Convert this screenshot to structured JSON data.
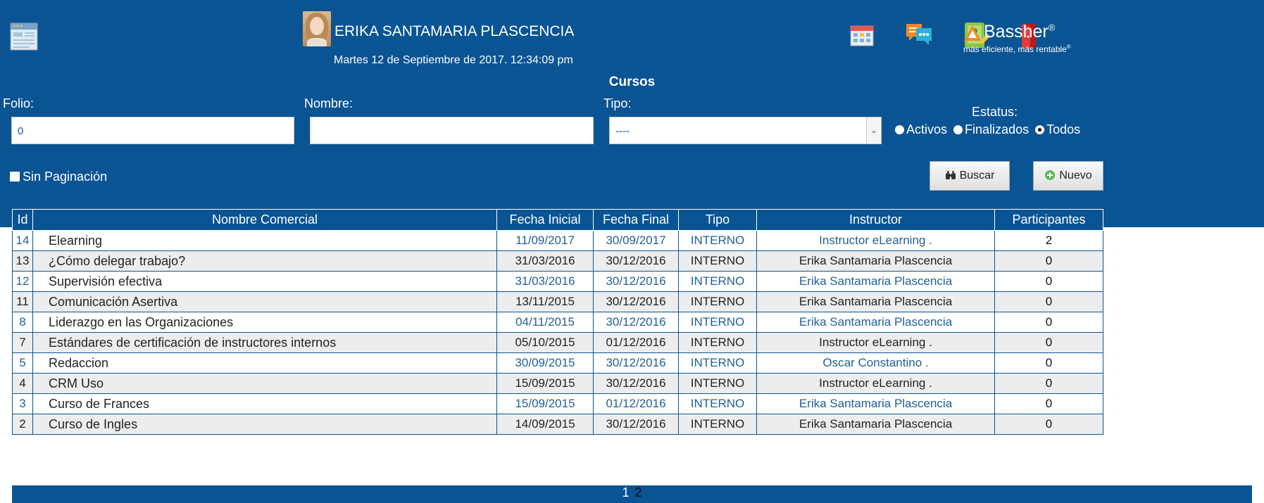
{
  "header": {
    "user_name": "ERIKA SANTAMARIA PLASCENCIA",
    "date": "Martes 12 de Septiembre de 2017. 12:34:09 pm",
    "brand_name": "Bassher",
    "brand_mark": "®",
    "brand_tagline": "más eficiente, más rentable",
    "brand_tagline_mark": "®",
    "icons": [
      "app-window-icon",
      "calendar-icon",
      "chat-icon",
      "tablet-user-icon",
      "exit-door-icon",
      "bassher-logo"
    ],
    "colors": {
      "header_bg": "#0a5494",
      "row_even_bg": "#ededed",
      "link_text": "#1f5f95"
    }
  },
  "page": {
    "title": "Cursos"
  },
  "filters": {
    "folio_label": "Folio:",
    "folio_value": "0",
    "nombre_label": "Nombre:",
    "nombre_value": "",
    "tipo_label": "Tipo:",
    "tipo_value": "----",
    "estatus_label": "Estatus:",
    "estatus_options": [
      "Activos",
      "Finalizados",
      "Todos"
    ],
    "estatus_selected": "Todos",
    "sin_paginacion_label": "Sin Paginación",
    "buscar_label": "Buscar",
    "nuevo_label": "Nuevo"
  },
  "table": {
    "headers": [
      "Id",
      "Nombre Comercial",
      "Fecha Inicial",
      "Fecha Final",
      "Tipo",
      "Instructor",
      "Participantes"
    ],
    "rows": [
      {
        "id": "14",
        "nombre": "Elearning",
        "inicio": "11/09/2017",
        "fin": "30/09/2017",
        "tipo": "INTERNO",
        "instructor": "Instructor eLearning .",
        "participantes": "2"
      },
      {
        "id": "13",
        "nombre": "¿Cómo delegar trabajo?",
        "inicio": "31/03/2016",
        "fin": "30/12/2016",
        "tipo": "INTERNO",
        "instructor": "Erika Santamaria Plascencia",
        "participantes": "0"
      },
      {
        "id": "12",
        "nombre": "Supervisión efectiva",
        "inicio": "31/03/2016",
        "fin": "30/12/2016",
        "tipo": "INTERNO",
        "instructor": "Erika Santamaria Plascencia",
        "participantes": "0"
      },
      {
        "id": "11",
        "nombre": "Comunicación Asertiva",
        "inicio": "13/11/2015",
        "fin": "30/12/2016",
        "tipo": "INTERNO",
        "instructor": "Erika Santamaria Plascencia",
        "participantes": "0"
      },
      {
        "id": "8",
        "nombre": "Liderazgo en las Organizaciones",
        "inicio": "04/11/2015",
        "fin": "30/12/2016",
        "tipo": "INTERNO",
        "instructor": "Erika Santamaria Plascencia",
        "participantes": "0"
      },
      {
        "id": "7",
        "nombre": "Estándares de certificación de instructores internos",
        "inicio": "05/10/2015",
        "fin": "01/12/2016",
        "tipo": "INTERNO",
        "instructor": "Instructor eLearning .",
        "participantes": "0"
      },
      {
        "id": "5",
        "nombre": "Redaccion",
        "inicio": "30/09/2015",
        "fin": "30/12/2016",
        "tipo": "INTERNO",
        "instructor": "Oscar Constantino .",
        "participantes": "0"
      },
      {
        "id": "4",
        "nombre": "CRM Uso",
        "inicio": "15/09/2015",
        "fin": "30/12/2016",
        "tipo": "INTERNO",
        "instructor": "Instructor eLearning .",
        "participantes": "0"
      },
      {
        "id": "3",
        "nombre": "Curso de Frances",
        "inicio": "15/09/2015",
        "fin": "01/12/2016",
        "tipo": "INTERNO",
        "instructor": "Erika Santamaria Plascencia",
        "participantes": "0"
      },
      {
        "id": "2",
        "nombre": "Curso de Ingles",
        "inicio": "14/09/2015",
        "fin": "30/12/2016",
        "tipo": "INTERNO",
        "instructor": "Erika Santamaria Plascencia",
        "participantes": "0"
      }
    ]
  },
  "pager": {
    "pages": [
      "1",
      "2"
    ]
  }
}
